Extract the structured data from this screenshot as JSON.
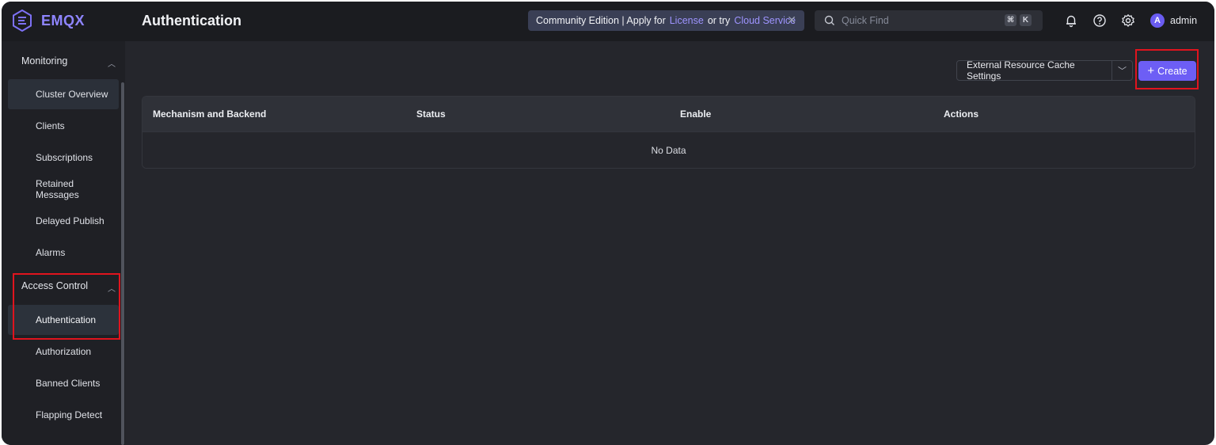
{
  "app": {
    "logo_text": "EMQX"
  },
  "header": {
    "page_title": "Authentication",
    "banner": {
      "text_before": "Community Edition | Apply for",
      "license_link": "License",
      "text_middle": "or try",
      "cloud_link": "Cloud Service",
      "close_icon": "close-icon"
    },
    "search": {
      "placeholder": "Quick Find",
      "shortcut_key_1": "⌘",
      "shortcut_key_2": "K"
    },
    "icons": [
      "bell-icon",
      "help-icon",
      "gear-icon"
    ],
    "user": {
      "avatar_letter": "A",
      "name": "admin"
    }
  },
  "sidebar": {
    "groups": [
      {
        "label": "Monitoring",
        "expanded": true,
        "items": [
          {
            "label": "Cluster Overview"
          },
          {
            "label": "Clients"
          },
          {
            "label": "Subscriptions"
          },
          {
            "label": "Retained Messages"
          },
          {
            "label": "Delayed Publish"
          },
          {
            "label": "Alarms"
          }
        ]
      },
      {
        "label": "Access Control",
        "expanded": true,
        "items": [
          {
            "label": "Authentication"
          },
          {
            "label": "Authorization"
          },
          {
            "label": "Banned Clients"
          },
          {
            "label": "Flapping Detect"
          }
        ]
      }
    ]
  },
  "toolbar": {
    "cache_settings_label": "External Resource Cache Settings",
    "create_label": "Create"
  },
  "table": {
    "columns": [
      "Mechanism and Backend",
      "Status",
      "Enable",
      "Actions"
    ],
    "empty_text": "No Data"
  },
  "colors": {
    "accent": "#6d5ef5",
    "highlight_box": "#e0141e",
    "background": "#25262c"
  }
}
